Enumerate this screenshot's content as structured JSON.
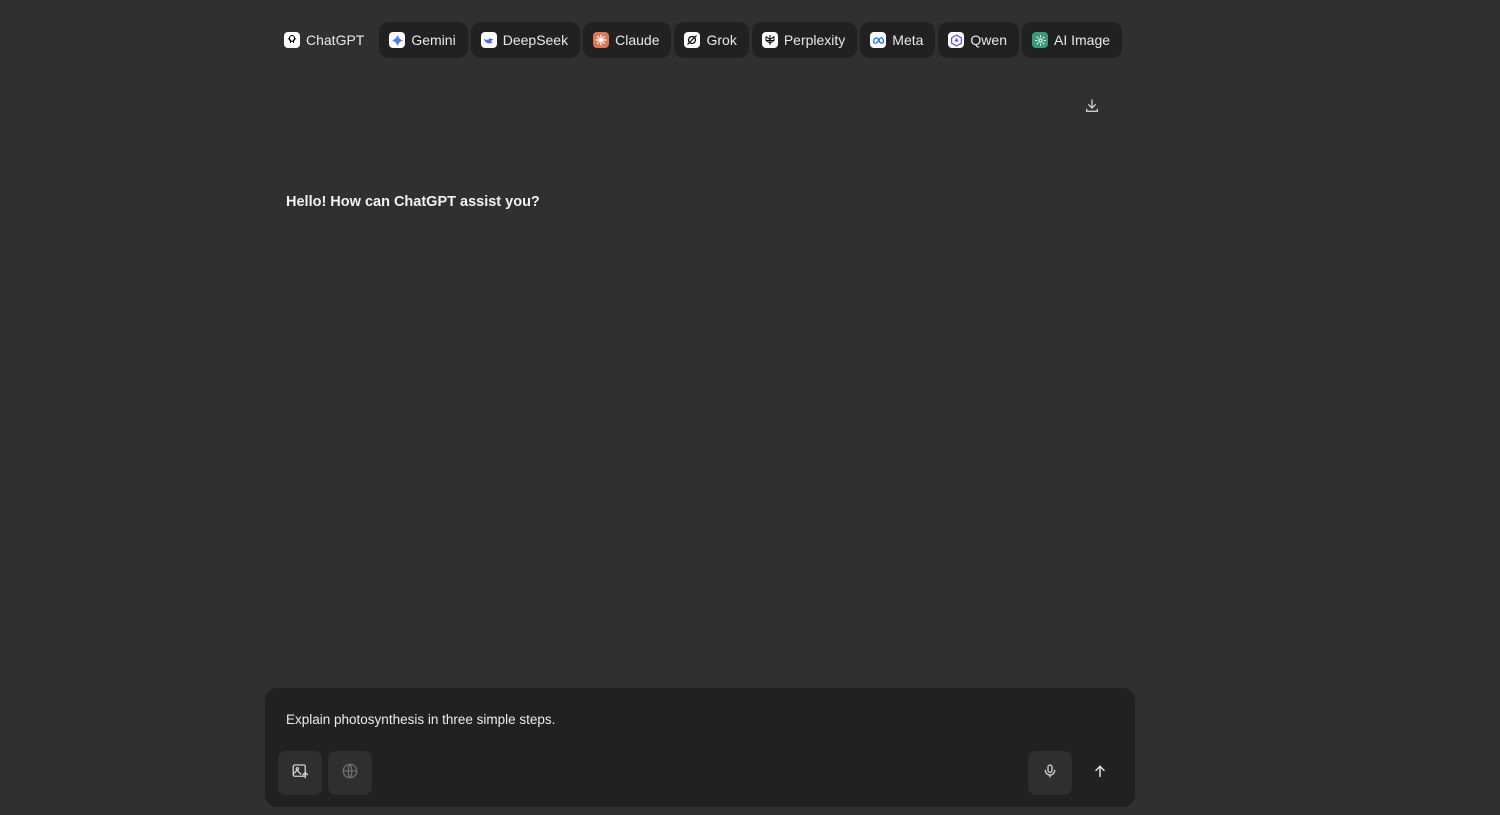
{
  "tabs": [
    {
      "label": "ChatGPT",
      "icon": "chatgpt-icon",
      "active": true,
      "color": "#ffffff"
    },
    {
      "label": "Gemini",
      "icon": "gemini-icon",
      "active": false,
      "color": "#ffffff"
    },
    {
      "label": "DeepSeek",
      "icon": "deepseek-icon",
      "active": false,
      "color": "#ffffff"
    },
    {
      "label": "Claude",
      "icon": "claude-icon",
      "active": false,
      "color": "#d97757"
    },
    {
      "label": "Grok",
      "icon": "grok-icon",
      "active": false,
      "color": "#ffffff"
    },
    {
      "label": "Perplexity",
      "icon": "perplexity-icon",
      "active": false,
      "color": "#ffffff"
    },
    {
      "label": "Meta",
      "icon": "meta-icon",
      "active": false,
      "color": "#ffffff"
    },
    {
      "label": "Qwen",
      "icon": "qwen-icon",
      "active": false,
      "color": "#ffffff"
    },
    {
      "label": "AI Image",
      "icon": "ai-image-icon",
      "active": false,
      "color": "#3a9a78"
    }
  ],
  "header": {
    "download_icon": "download-icon"
  },
  "chat": {
    "greeting": "Hello! How can ChatGPT assist you?"
  },
  "composer": {
    "input_value": "Explain photosynthesis in three simple steps.",
    "upload_image_icon": "image-upload-icon",
    "web_search_icon": "globe-icon",
    "mic_icon": "microphone-icon",
    "send_icon": "arrow-up-icon"
  },
  "colors": {
    "background": "#303030",
    "surface": "#212121",
    "button": "#2f2f2f",
    "text": "#ececec"
  }
}
